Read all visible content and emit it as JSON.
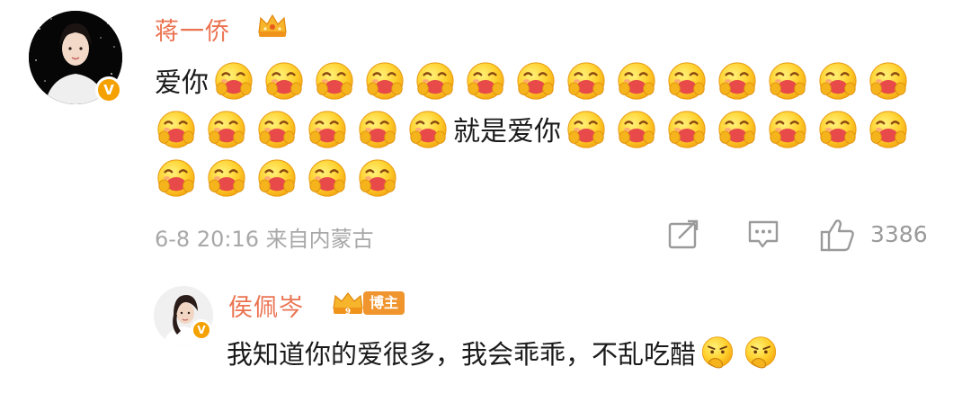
{
  "comment": {
    "username": "蒋一侨",
    "line1_text_a": "爱你",
    "line2_text_b": "就是爱你",
    "meta": "6-8 20:16 来自内蒙古",
    "like_count": "3386",
    "verified_badge": "V"
  },
  "reply": {
    "username": "侯佩岑",
    "role_badge": "博主",
    "text": "我知道你的爱很多，我会乖乖，不乱吃醋",
    "verified_badge": "V",
    "crown_level": "9"
  },
  "icons": {
    "share": "share-icon",
    "comment": "comment-icon",
    "like": "thumbs-up-icon",
    "hug_emoji": "hug-emoji-icon",
    "thinking_emoji": "thinking-emoji-icon"
  },
  "colors": {
    "username": "#eb7350",
    "meta": "#a8a8a8",
    "badge": "#f0942e",
    "verified": "#f5a100"
  }
}
